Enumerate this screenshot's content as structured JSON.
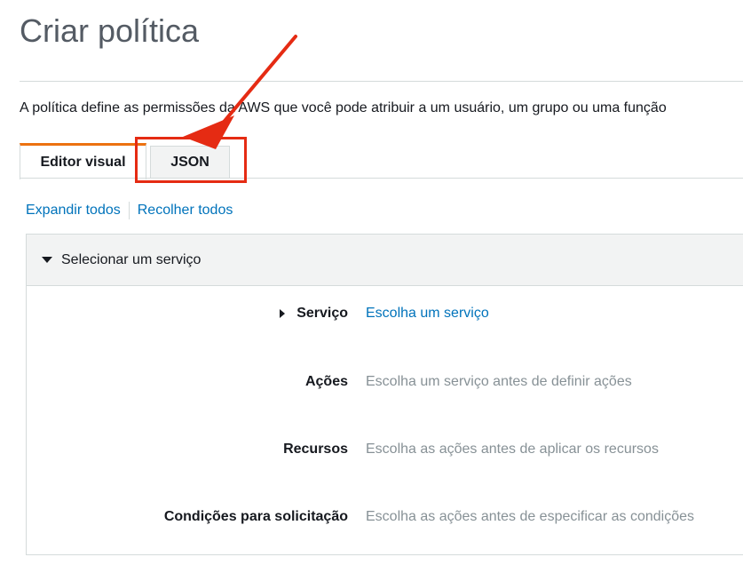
{
  "page": {
    "title": "Criar política",
    "description": "A política define as permissões da AWS que você pode atribuir a um usuário, um grupo ou uma função"
  },
  "tabs": [
    {
      "label": "Editor visual",
      "active": true
    },
    {
      "label": "JSON",
      "active": false
    }
  ],
  "links": {
    "expand_all": "Expandir todos",
    "collapse_all": "Recolher todos"
  },
  "panel": {
    "header": "Selecionar um serviço",
    "rows": [
      {
        "label": "Serviço",
        "value": "Escolha um serviço"
      },
      {
        "label": "Ações",
        "value": "Escolha um serviço antes de definir ações"
      },
      {
        "label": "Recursos",
        "value": "Escolha as ações antes de aplicar os recursos"
      },
      {
        "label": "Condições para solicitação",
        "value": "Escolha as ações antes de especificar as condições"
      }
    ]
  },
  "colors": {
    "accent": "#ec7211",
    "link": "#0073bb",
    "annotation": "#e52b13"
  }
}
